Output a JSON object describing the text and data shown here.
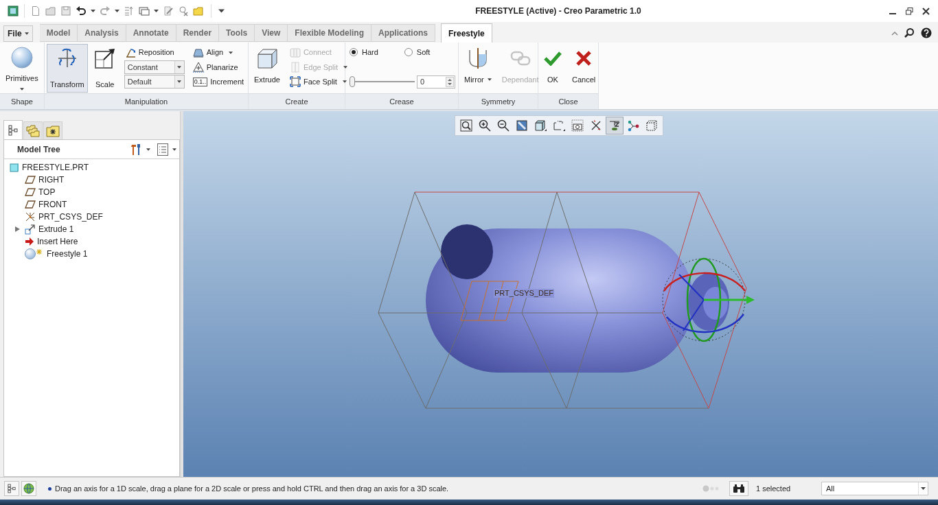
{
  "window": {
    "title": "FREESTYLE (Active) - Creo Parametric 1.0"
  },
  "file_menu": {
    "label": "File"
  },
  "tabs": [
    {
      "label": "Model",
      "selected": false
    },
    {
      "label": "Analysis",
      "selected": false
    },
    {
      "label": "Annotate",
      "selected": false
    },
    {
      "label": "Render",
      "selected": false
    },
    {
      "label": "Tools",
      "selected": false
    },
    {
      "label": "View",
      "selected": false
    },
    {
      "label": "Flexible Modeling",
      "selected": false
    },
    {
      "label": "Applications",
      "selected": false
    },
    {
      "label": "Freestyle",
      "selected": true
    }
  ],
  "ribbon": [
    {
      "label": "Shape",
      "items": [
        {
          "kind": "large",
          "label": "Primitives",
          "menu": true,
          "selected": false,
          "disabled": false
        }
      ]
    },
    {
      "label": "Manipulation",
      "items": [
        {
          "kind": "large",
          "label": "Transform",
          "menu": false,
          "selected": true,
          "disabled": false
        },
        {
          "kind": "large",
          "label": "Scale",
          "menu": false,
          "selected": false,
          "disabled": false
        },
        {
          "kind": "small",
          "label": "Reposition",
          "menu": false,
          "disabled": false
        },
        {
          "kind": "select",
          "value": "Constant"
        },
        {
          "kind": "select",
          "value": "Default"
        },
        {
          "kind": "small",
          "label": "Align",
          "menu": true,
          "disabled": false
        },
        {
          "kind": "small",
          "label": "Planarize",
          "menu": false,
          "disabled": false
        },
        {
          "kind": "small",
          "label": "Increment",
          "icon_text": "0.1..",
          "menu": false,
          "disabled": false
        }
      ]
    },
    {
      "label": "Create",
      "items": [
        {
          "kind": "large",
          "label": "Extrude",
          "menu": false,
          "selected": false,
          "disabled": false
        },
        {
          "kind": "small",
          "label": "Connect",
          "menu": false,
          "disabled": true
        },
        {
          "kind": "small",
          "label": "Edge Split",
          "menu": true,
          "disabled": true
        },
        {
          "kind": "small",
          "label": "Face Split",
          "menu": true,
          "disabled": false
        }
      ]
    },
    {
      "label": "Crease",
      "items": [
        {
          "kind": "radio",
          "label": "Hard",
          "selected": true
        },
        {
          "kind": "radio",
          "label": "Soft",
          "selected": false
        },
        {
          "kind": "slider",
          "level": 0,
          "value": "0"
        }
      ]
    },
    {
      "label": "Symmetry",
      "items": [
        {
          "kind": "large",
          "label": "Mirror",
          "menu": true,
          "selected": false,
          "disabled": false
        },
        {
          "kind": "large",
          "label": "Dependant",
          "menu": false,
          "selected": false,
          "disabled": true
        }
      ]
    },
    {
      "label": "Close",
      "items": [
        {
          "kind": "large",
          "label": "OK",
          "menu": false,
          "selected": false,
          "disabled": false
        },
        {
          "kind": "large",
          "label": "Cancel",
          "menu": false,
          "selected": false,
          "disabled": false
        }
      ]
    }
  ],
  "panel": {
    "tabs": [
      {
        "selected": true
      },
      {
        "selected": false
      },
      {
        "selected": false
      }
    ],
    "title": "Model Tree",
    "tree": {
      "label": "FREESTYLE.PRT",
      "kind": "part",
      "children": [
        {
          "label": "RIGHT",
          "kind": "plane"
        },
        {
          "label": "TOP",
          "kind": "plane"
        },
        {
          "label": "FRONT",
          "kind": "plane"
        },
        {
          "label": "PRT_CSYS_DEF",
          "kind": "csys"
        },
        {
          "label": "Extrude 1",
          "kind": "extrude",
          "expanded": false
        },
        {
          "label": "Insert Here",
          "kind": "insert"
        },
        {
          "label": "Freestyle 1",
          "kind": "freestyle"
        }
      ]
    }
  },
  "viewport": {
    "toolbar": [
      {
        "on": false
      },
      {
        "on": false
      },
      {
        "on": false
      },
      {
        "on": false
      },
      {
        "on": false
      },
      {
        "on": false
      },
      {
        "on": false
      },
      {
        "on": false
      },
      {
        "on": true
      },
      {
        "on": false
      },
      {
        "on": false
      }
    ],
    "csys_label": "PRT_CSYS_DEF"
  },
  "status_bar": {
    "message": "Drag an axis for a 1D scale, drag a plane for a 2D scale or press and hold CTRL and then drag an axis for a 3D scale.",
    "selection": "1 selected",
    "filter": "All"
  }
}
